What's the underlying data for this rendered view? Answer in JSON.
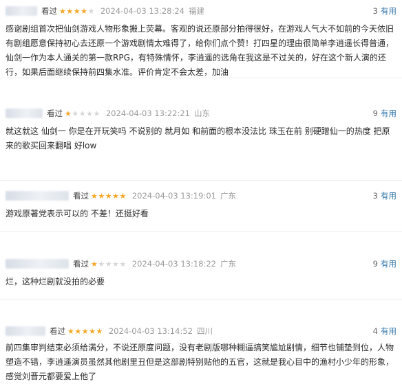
{
  "reviews": [
    {
      "watched": "看过",
      "stars": 4,
      "time": "2024-04-03 13:28:24",
      "location": "福建",
      "useful_count": "3",
      "useful_label": "有用",
      "content": "感谢剧组首次把仙剑游戏人物形象搬上荧幕。客观的说还原部分拍得很好，在游戏人气大不如前的今天依旧有剧组愿意保持初心去还原一个游戏剧情太难得了，给你们点个赞！打四星的理由很简单李逍遥长得普通，仙剑一作为本人通关的第一款RPG，有特殊情怀，李逍遥的选角在我这是不过关的，好在这个新人演的还行，如果后面继续保持前四集水准。评价肯定不会太差，加油"
    },
    {
      "watched": "看过",
      "stars": 1,
      "time": "2024-04-03 13:22:21",
      "location": "山东",
      "useful_count": "9",
      "useful_label": "有用",
      "content": "就这就这 仙剑一 你是在开玩笑吗 不说别的 就月如 和前面的根本没法比 珠玉在前 别硬蹭仙一的热度 把原来的歌买回来翻唱 好low"
    },
    {
      "watched": "看过",
      "stars": 5,
      "time": "2024-04-03 13:19:01",
      "location": "广东",
      "useful_count": "3",
      "useful_label": "有用",
      "content": "游戏原著党表示可以的 不差！还挺好看"
    },
    {
      "watched": "看过",
      "stars": 1,
      "time": "2024-04-03 13:18:22",
      "location": "广东",
      "useful_count": "9",
      "useful_label": "有用",
      "content": "烂，这种烂剧就没拍的必要"
    },
    {
      "watched": "看过",
      "stars": 5,
      "time": "2024-04-03 13:14:52",
      "location": "四川",
      "useful_count": "4",
      "useful_label": "有用",
      "content": "前四集审判结束必须给满分，不说还原度问题，没有老剧版哪种糊逼搞笑尴尬剧情，细节也铺垫到位，人物塑造不错，李逍遥演员虽然其他剧里丑但是这部剧特别贴他的五官，这就是我心目中的渔村小少年的形象，感觉刘晋元都要爱上他了"
    }
  ]
}
